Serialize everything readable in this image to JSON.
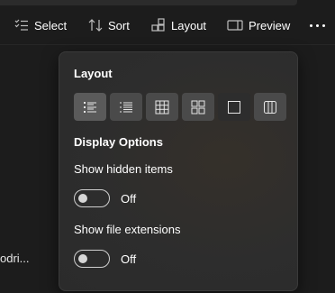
{
  "toolbar": {
    "select_label": "Select",
    "sort_label": "Sort",
    "layout_label": "Layout",
    "preview_label": "Preview"
  },
  "background": {
    "item_label": "odri..."
  },
  "flyout": {
    "layout_heading": "Layout",
    "layout_buttons": [
      {
        "name": "details-view",
        "icon": "details-list-icon"
      },
      {
        "name": "list-view",
        "icon": "list-icon"
      },
      {
        "name": "grid-view",
        "icon": "grid-icon"
      },
      {
        "name": "tiles-view",
        "icon": "tiles-icon"
      },
      {
        "name": "large-view",
        "icon": "square-icon"
      },
      {
        "name": "columns-view",
        "icon": "columns-icon"
      }
    ],
    "display_heading": "Display Options",
    "hidden_items_label": "Show hidden items",
    "hidden_items_state": "Off",
    "file_ext_label": "Show file extensions",
    "file_ext_state": "Off"
  }
}
